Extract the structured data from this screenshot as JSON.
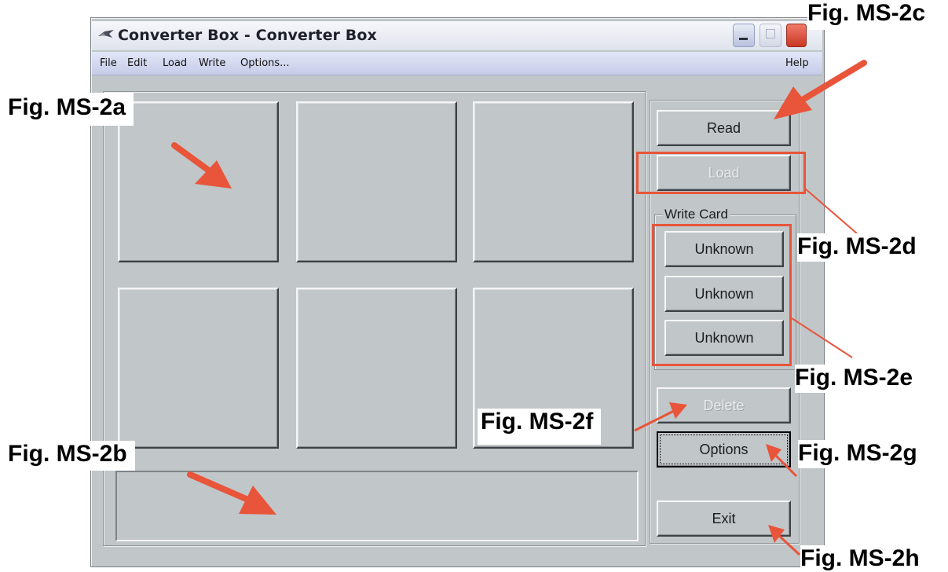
{
  "window": {
    "title": "Converter Box - Converter Box"
  },
  "menu": {
    "items": [
      "File",
      "Edit",
      "Load",
      "Write",
      "Options..."
    ],
    "help": "Help"
  },
  "buttons": {
    "read": "Read",
    "load": "Load",
    "write_card_legend": "Write Card",
    "write1": "Unknown",
    "write2": "Unknown",
    "write3": "Unknown",
    "delete": "Delete",
    "options": "Options",
    "exit": "Exit"
  },
  "annotations": {
    "fig_2a": "Fig. MS-2a",
    "fig_2b": "Fig. MS-2b",
    "fig_2c": "Fig. MS-2c",
    "fig_2d": "Fig. MS-2d",
    "fig_2e": "Fig. MS-2e",
    "fig_2f": "Fig. MS-2f",
    "fig_2g": "Fig. MS-2g",
    "fig_2h": "Fig. MS-2h"
  },
  "colors": {
    "window_bg": "#c1c6c8",
    "annotation_red": "#e8553a"
  }
}
